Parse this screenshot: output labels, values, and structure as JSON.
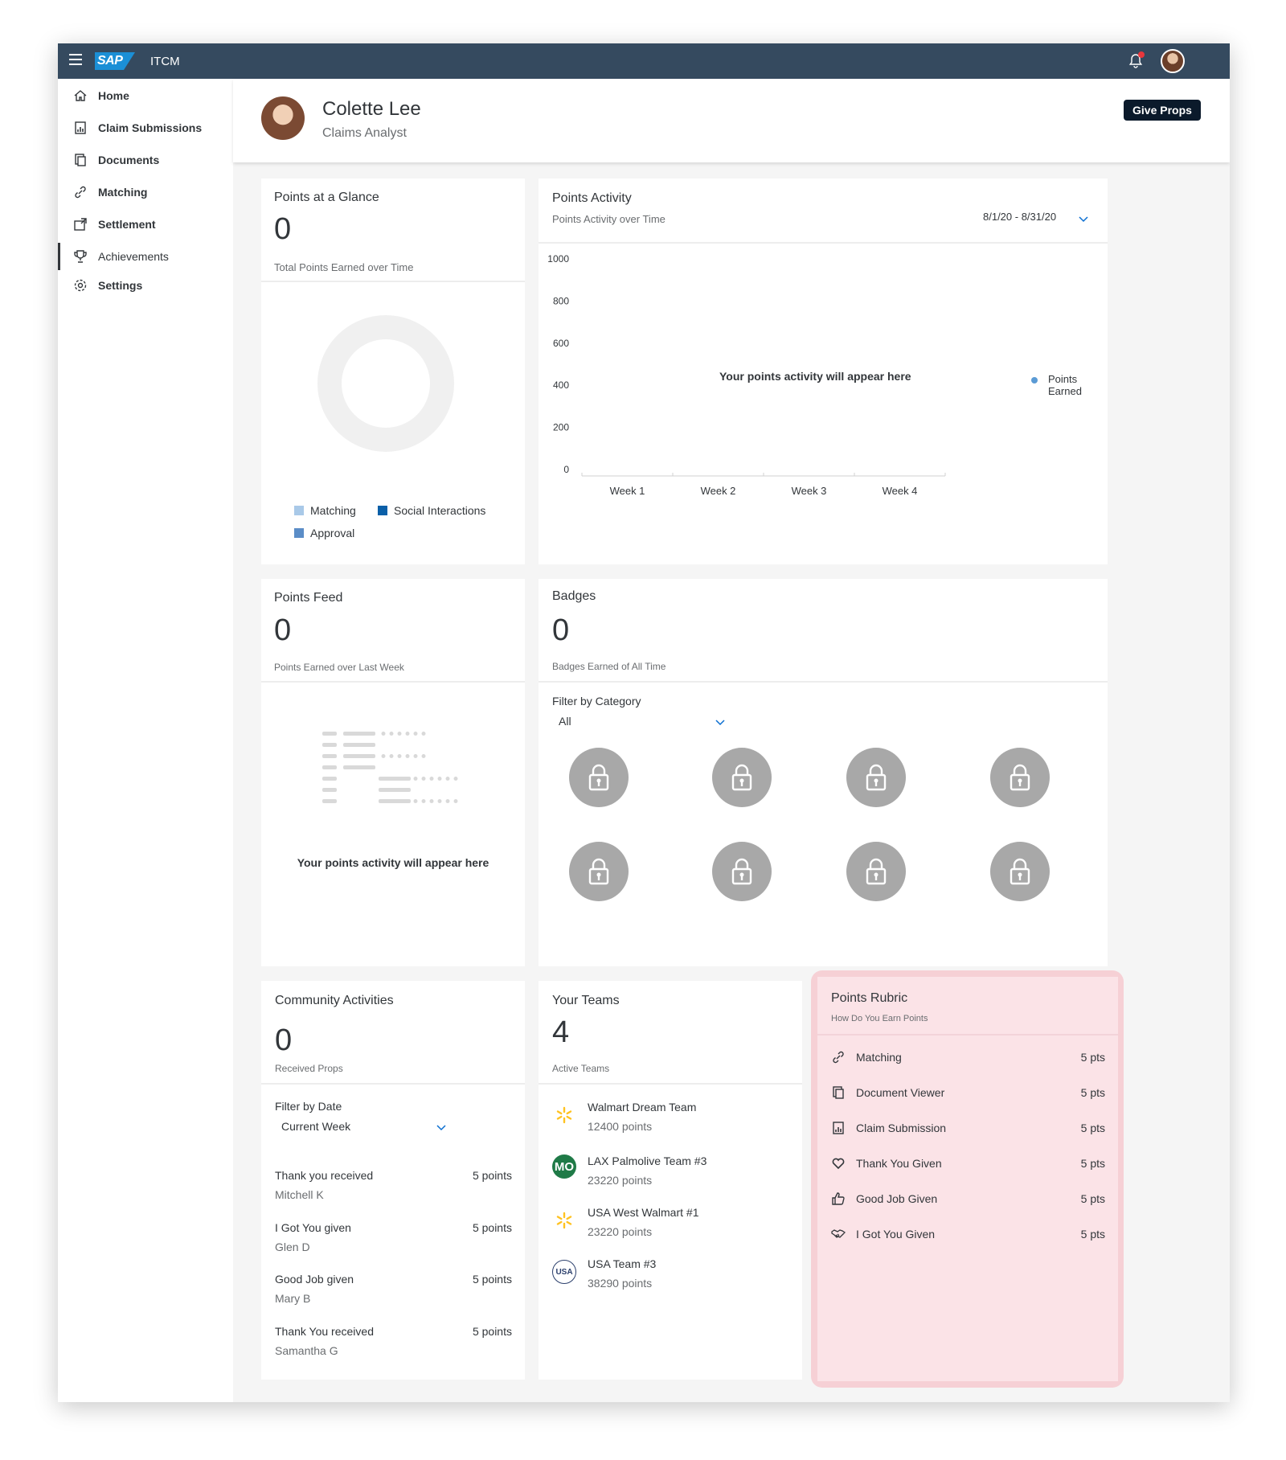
{
  "shell": {
    "app_title": "ITCM",
    "logo_text": "SAP"
  },
  "sidebar": {
    "items": [
      {
        "label": "Home",
        "icon": "home-icon"
      },
      {
        "label": "Claim Submissions",
        "icon": "claim-icon"
      },
      {
        "label": "Documents",
        "icon": "document-icon"
      },
      {
        "label": "Matching",
        "icon": "link-icon"
      },
      {
        "label": "Settlement",
        "icon": "settlement-icon"
      },
      {
        "label": "Achievements",
        "icon": "trophy-icon",
        "active": true
      },
      {
        "label": "Settings",
        "icon": "gear-icon"
      }
    ]
  },
  "header": {
    "name": "Colette Lee",
    "role": "Claims Analyst",
    "give_props_label": "Give Props"
  },
  "glance": {
    "title": "Points at a Glance",
    "value": "0",
    "subtitle": "Total Points Earned over Time",
    "legend": [
      {
        "label": "Matching",
        "color": "#a9c9e8"
      },
      {
        "label": "Social Interactions",
        "color": "#0a5fa8"
      },
      {
        "label": "Approval",
        "color": "#5b8dc7"
      }
    ]
  },
  "activity": {
    "title": "Points Activity",
    "subtitle": "Points Activity over Time",
    "date_range": "8/1/20 - 8/31/20",
    "empty_message": "Your points activity will appear here",
    "legend_label": "Points Earned",
    "legend_color": "#5b9bd5"
  },
  "chart_data": {
    "type": "line",
    "categories": [
      "Week 1",
      "Week 2",
      "Week 3",
      "Week 4"
    ],
    "series": [
      {
        "name": "Points Earned",
        "values": []
      }
    ],
    "yticks": [
      0,
      200,
      400,
      600,
      800,
      1000
    ],
    "ylim": [
      0,
      1000
    ],
    "xlabel": "",
    "ylabel": "",
    "title": "",
    "grid": false,
    "legend": "right"
  },
  "feed": {
    "title": "Points Feed",
    "value": "0",
    "subtitle": "Points Earned over Last Week",
    "empty_message": "Your points activity will appear here"
  },
  "badges": {
    "title": "Badges",
    "value": "0",
    "subtitle": "Badges Earned of All Time",
    "filter_label": "Filter by Category",
    "filter_value": "All",
    "count": 8
  },
  "community": {
    "title": "Community Activities",
    "value": "0",
    "subtitle": "Received Props",
    "filter_label": "Filter by Date",
    "filter_value": "Current Week",
    "items": [
      {
        "title": "Thank you received",
        "person": "Mitchell K",
        "points": "5 points"
      },
      {
        "title": "I Got You given",
        "person": "Glen D",
        "points": "5 points"
      },
      {
        "title": "Good Job given",
        "person": "Mary B",
        "points": "5 points"
      },
      {
        "title": "Thank You received",
        "person": "Samantha G",
        "points": "5 points"
      }
    ]
  },
  "teams": {
    "title": "Your Teams",
    "value": "4",
    "subtitle": "Active Teams",
    "items": [
      {
        "name": "Walmart Dream Team",
        "points": "12400 points",
        "logo": "walmart-logo-icon"
      },
      {
        "name": "LAX Palmolive Team #3",
        "points": "23220 points",
        "logo": "palmolive-logo-icon",
        "logo_text": "MO"
      },
      {
        "name": "USA West Walmart #1",
        "points": "23220 points",
        "logo": "walmart-logo-icon"
      },
      {
        "name": "USA Team #3",
        "points": "38290 points",
        "logo": "usa-logo-icon",
        "logo_text": "USA"
      }
    ]
  },
  "rubric": {
    "title": "Points Rubric",
    "subtitle": "How Do You Earn Points",
    "items": [
      {
        "label": "Matching",
        "points": "5 pts",
        "icon": "link-icon"
      },
      {
        "label": "Document Viewer",
        "points": "5 pts",
        "icon": "document-icon"
      },
      {
        "label": "Claim Submission",
        "points": "5 pts",
        "icon": "claim-icon"
      },
      {
        "label": "Thank You Given",
        "points": "5 pts",
        "icon": "heart-icon"
      },
      {
        "label": "Good Job Given",
        "points": "5 pts",
        "icon": "thumbs-up-icon"
      },
      {
        "label": "I Got You Given",
        "points": "5 pts",
        "icon": "handshake-icon"
      }
    ]
  }
}
